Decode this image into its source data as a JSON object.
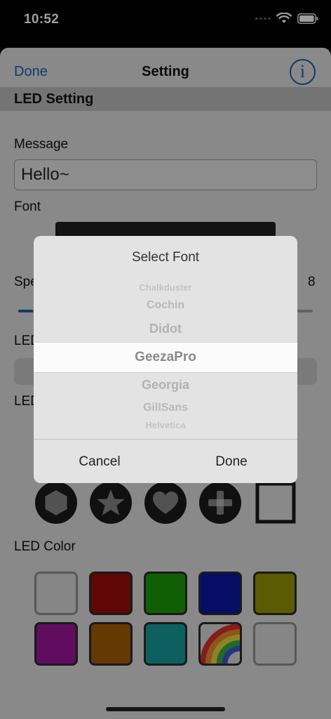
{
  "status_bar": {
    "time": "10:52"
  },
  "nav": {
    "done_label": "Done",
    "title": "Setting",
    "info_glyph": "i"
  },
  "section_title": "LED Setting",
  "message": {
    "label": "Message",
    "value": "Hello~"
  },
  "font": {
    "label": "Font"
  },
  "speed": {
    "label_visible": "Spe",
    "value": "8",
    "fill_fraction": 0.05
  },
  "led_bg": {
    "label_visible": "LED"
  },
  "led_shape": {
    "label_visible": "LED",
    "shapes": [
      "hexagon-icon",
      "star-icon",
      "heart-icon",
      "plus-icon",
      "square-icon"
    ]
  },
  "led_color": {
    "label": "LED Color",
    "swatches": [
      "#d8d8d8",
      "#9a0d07",
      "#1b9a07",
      "#0b16a3",
      "#939406",
      "#9b1599",
      "#a45c08",
      "#179c9b",
      "rainbow",
      "#d8d8d8"
    ]
  },
  "font_dialog": {
    "title": "Select Font",
    "options": [
      "Chalkduster",
      "Cochin",
      "Didot",
      "GeezaPro",
      "Georgia",
      "GillSans",
      "Helvetica"
    ],
    "selected": "GeezaPro",
    "cancel_label": "Cancel",
    "done_label": "Done"
  }
}
